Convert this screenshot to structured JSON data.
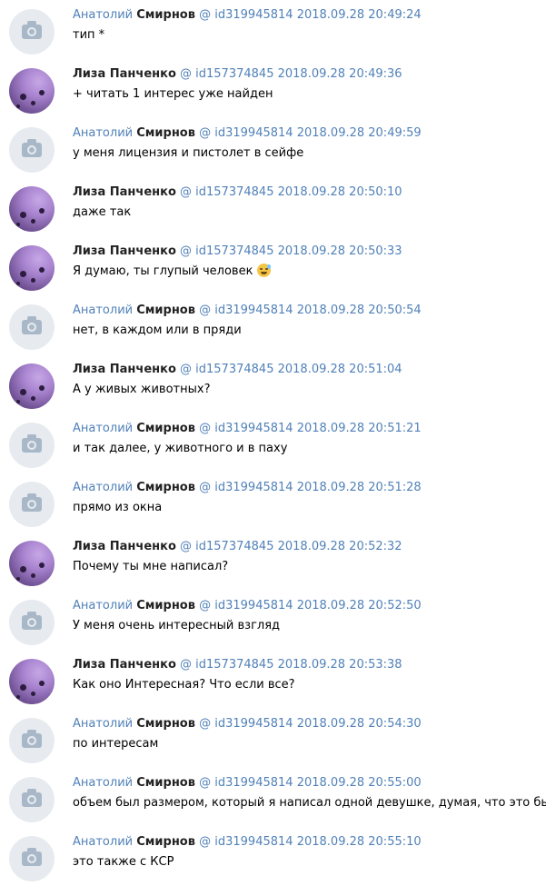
{
  "messages": [
    {
      "author_first": "Анатолий",
      "author_last": "Смирнов",
      "author_id": "id319945814",
      "at": "@",
      "timestamp": "2018.09.28 20:49:24",
      "text": "тип *",
      "avatar": "camera-icon"
    },
    {
      "author_first": "",
      "author_last": "Лиза Панченко",
      "author_id": "id157374845",
      "at": "@",
      "timestamp": "2018.09.28 20:49:36",
      "text": "+ читать 1 интерес уже найден",
      "avatar": "photo"
    },
    {
      "author_first": "Анатолий",
      "author_last": "Смирнов",
      "author_id": "id319945814",
      "at": "@",
      "timestamp": "2018.09.28 20:49:59",
      "text": "у меня лицензия и пистолет в сейфе",
      "avatar": "camera-icon"
    },
    {
      "author_first": "",
      "author_last": "Лиза Панченко",
      "author_id": "id157374845",
      "at": "@",
      "timestamp": "2018.09.28 20:50:10",
      "text": "даже так",
      "avatar": "photo"
    },
    {
      "author_first": "",
      "author_last": "Лиза Панченко",
      "author_id": "id157374845",
      "at": "@",
      "timestamp": "2018.09.28 20:50:33",
      "text": "Я думаю, ты глупый человек",
      "emoji": "sweat-smile-emoji",
      "avatar": "photo"
    },
    {
      "author_first": "Анатолий",
      "author_last": "Смирнов",
      "author_id": "id319945814",
      "at": "@",
      "timestamp": "2018.09.28 20:50:54",
      "text": "нет, в каждом или в пряди",
      "avatar": "camera-icon"
    },
    {
      "author_first": "",
      "author_last": "Лиза Панченко",
      "author_id": "id157374845",
      "at": "@",
      "timestamp": "2018.09.28 20:51:04",
      "text": "А у живых животных?",
      "avatar": "photo"
    },
    {
      "author_first": "Анатолий",
      "author_last": "Смирнов",
      "author_id": "id319945814",
      "at": "@",
      "timestamp": "2018.09.28 20:51:21",
      "text": "и так далее, у животного и в паху",
      "avatar": "camera-icon"
    },
    {
      "author_first": "Анатолий",
      "author_last": "Смирнов",
      "author_id": "id319945814",
      "at": "@",
      "timestamp": "2018.09.28 20:51:28",
      "text": "прямо из окна",
      "avatar": "camera-icon"
    },
    {
      "author_first": "",
      "author_last": "Лиза Панченко",
      "author_id": "id157374845",
      "at": "@",
      "timestamp": "2018.09.28 20:52:32",
      "text": "Почему ты мне написал?",
      "avatar": "photo"
    },
    {
      "author_first": "Анатолий",
      "author_last": "Смирнов",
      "author_id": "id319945814",
      "at": "@",
      "timestamp": "2018.09.28 20:52:50",
      "text": "У меня очень интересный взгляд",
      "avatar": "camera-icon"
    },
    {
      "author_first": "",
      "author_last": "Лиза Панченко",
      "author_id": "id157374845",
      "at": "@",
      "timestamp": "2018.09.28 20:53:38",
      "text": "Как оно Интересная? Что если все?",
      "avatar": "photo"
    },
    {
      "author_first": "Анатолий",
      "author_last": "Смирнов",
      "author_id": "id319945814",
      "at": "@",
      "timestamp": "2018.09.28 20:54:30",
      "text": "по интересам",
      "avatar": "camera-icon"
    },
    {
      "author_first": "Анатолий",
      "author_last": "Смирнов",
      "author_id": "id319945814",
      "at": "@",
      "timestamp": "2018.09.28 20:55:00",
      "text": "объем был размером, который я написал одной девушке, думая, что это было",
      "avatar": "camera-icon"
    },
    {
      "author_first": "Анатолий",
      "author_last": "Смирнов",
      "author_id": "id319945814",
      "at": "@",
      "timestamp": "2018.09.28 20:55:10",
      "text": "это также с КСР",
      "avatar": "camera-icon"
    }
  ],
  "colors": {
    "link": "#5181b8",
    "name": "#222222",
    "text": "#000000"
  }
}
